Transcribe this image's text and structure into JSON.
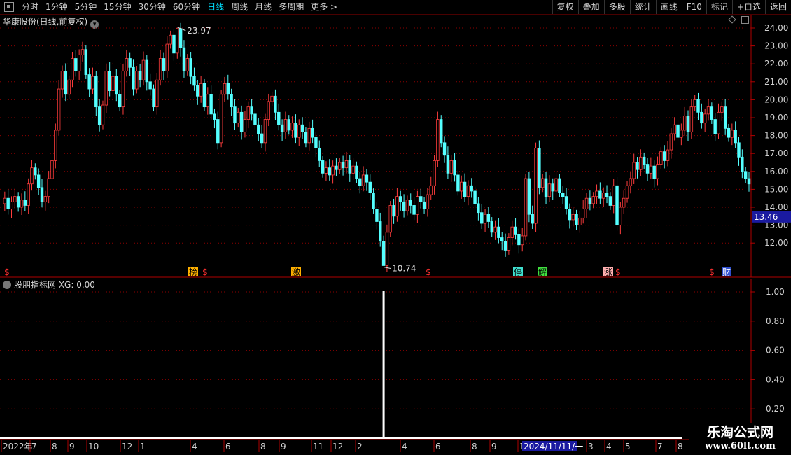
{
  "toolbar": {
    "tabs": [
      "分时",
      "1分钟",
      "5分钟",
      "15分钟",
      "30分钟",
      "60分钟",
      "日线",
      "周线",
      "月线",
      "多周期",
      "更多 >"
    ],
    "active_tab": "日线",
    "right_buttons": [
      "复权",
      "叠加",
      "多股",
      "统计",
      "画线",
      "F10",
      "标记",
      "+自选",
      "返回"
    ]
  },
  "main_panel": {
    "title": "华康股份(日线,前复权)",
    "y_ticks": [
      "24.00",
      "23.00",
      "22.00",
      "21.00",
      "20.00",
      "19.00",
      "18.00",
      "17.00",
      "16.00",
      "15.00",
      "14.00",
      "13.00",
      "12.00"
    ],
    "current_price": "13.46",
    "high_label": "23.97",
    "low_label": "10.74",
    "event_tags": [
      "$",
      "榜",
      "$",
      "激",
      "$",
      "停",
      "解",
      "涨",
      "$",
      "$",
      "财"
    ]
  },
  "indicator_panel": {
    "title": "股朋指标网  XG: 0.00",
    "y_ticks": [
      "1.00",
      "0.80",
      "0.60",
      "0.40",
      "0.20"
    ]
  },
  "time_axis": {
    "labels": [
      "2022年",
      "7",
      "8",
      "9",
      "10",
      "12",
      "1",
      "4",
      "6",
      "8",
      "9",
      "11",
      "12",
      "2",
      "4",
      "6",
      "8",
      "9",
      "1",
      "3",
      "4",
      "5",
      "7",
      "8"
    ],
    "highlight": "2024/11/11/一"
  },
  "watermark": {
    "line1": "乐淘公式网",
    "line2": "www.60lt.com"
  },
  "colors": {
    "up": "#ff3c3c",
    "down": "#54ffff",
    "grid": "#8b0000",
    "axis": "#b00000",
    "highlight_bg": "#1a1aa0"
  },
  "price_path": [
    14.2,
    14.5,
    13.9,
    14.3,
    14.6,
    14.0,
    14.4,
    14.1,
    15.3,
    16.2,
    15.8,
    15.1,
    14.3,
    14.6,
    15.6,
    16.6,
    18.3,
    20.6,
    21.6,
    20.3,
    21.1,
    22.3,
    21.6,
    22.5,
    22.8,
    21.4,
    20.6,
    21.3,
    19.6,
    18.6,
    19.7,
    21.6,
    20.5,
    21.3,
    20.3,
    19.6,
    21.6,
    22.3,
    21.8,
    20.6,
    21.6,
    21.1,
    22.2,
    21.0,
    20.6,
    19.6,
    21.1,
    22.3,
    21.6,
    23.1,
    23.6,
    22.6,
    23.97,
    22.9,
    21.6,
    22.3,
    21.3,
    20.8,
    20.2,
    20.9,
    19.6,
    20.3,
    19.2,
    18.9,
    17.6,
    20.3,
    20.9,
    20.3,
    19.6,
    18.7,
    19.3,
    18.2,
    18.9,
    19.6,
    19.2,
    18.6,
    18.1,
    17.6,
    18.9,
    19.9,
    20.2,
    19.3,
    18.6,
    18.2,
    18.9,
    18.3,
    18.7,
    17.9,
    18.6,
    18.2,
    17.6,
    18.4,
    17.9,
    17.3,
    16.6,
    15.9,
    16.2,
    15.8,
    16.3,
    16.1,
    16.5,
    16.2,
    16.6,
    15.9,
    16.3,
    15.6,
    15.2,
    15.8,
    15.4,
    14.8,
    13.9,
    13.2,
    12.1,
    10.74,
    12.6,
    14.1,
    13.5,
    14.6,
    14.3,
    13.8,
    14.4,
    14.1,
    13.6,
    14.6,
    14.3,
    13.9,
    14.7,
    15.2,
    16.6,
    18.9,
    17.6,
    16.9,
    15.9,
    16.6,
    15.8,
    14.9,
    15.4,
    14.6,
    15.2,
    14.9,
    14.2,
    13.7,
    13.1,
    13.6,
    13.2,
    12.6,
    12.9,
    12.3,
    12.1,
    11.6,
    12.3,
    12.9,
    12.5,
    11.9,
    12.4,
    15.6,
    13.6,
    13.1,
    17.3,
    15.1,
    15.6,
    14.6,
    15.3,
    14.9,
    15.6,
    14.8,
    14.6,
    13.9,
    13.3,
    13.6,
    13.0,
    13.4,
    13.9,
    14.5,
    14.2,
    14.6,
    14.9,
    14.5,
    14.8,
    14.6,
    14.1,
    15.2,
    13.0,
    14.0,
    14.5,
    15.2,
    15.6,
    16.5,
    16.1,
    16.8,
    16.4,
    15.9,
    16.3,
    15.6,
    16.4,
    17.1,
    16.6,
    17.2,
    18.1,
    18.6,
    17.9,
    18.3,
    19.1,
    18.2,
    19.6,
    20.0,
    19.3,
    18.7,
    19.2,
    19.6,
    18.9,
    18.1,
    19.3,
    19.6,
    18.4,
    17.9,
    18.3,
    17.6,
    16.8,
    16.0,
    15.6,
    15.3
  ]
}
